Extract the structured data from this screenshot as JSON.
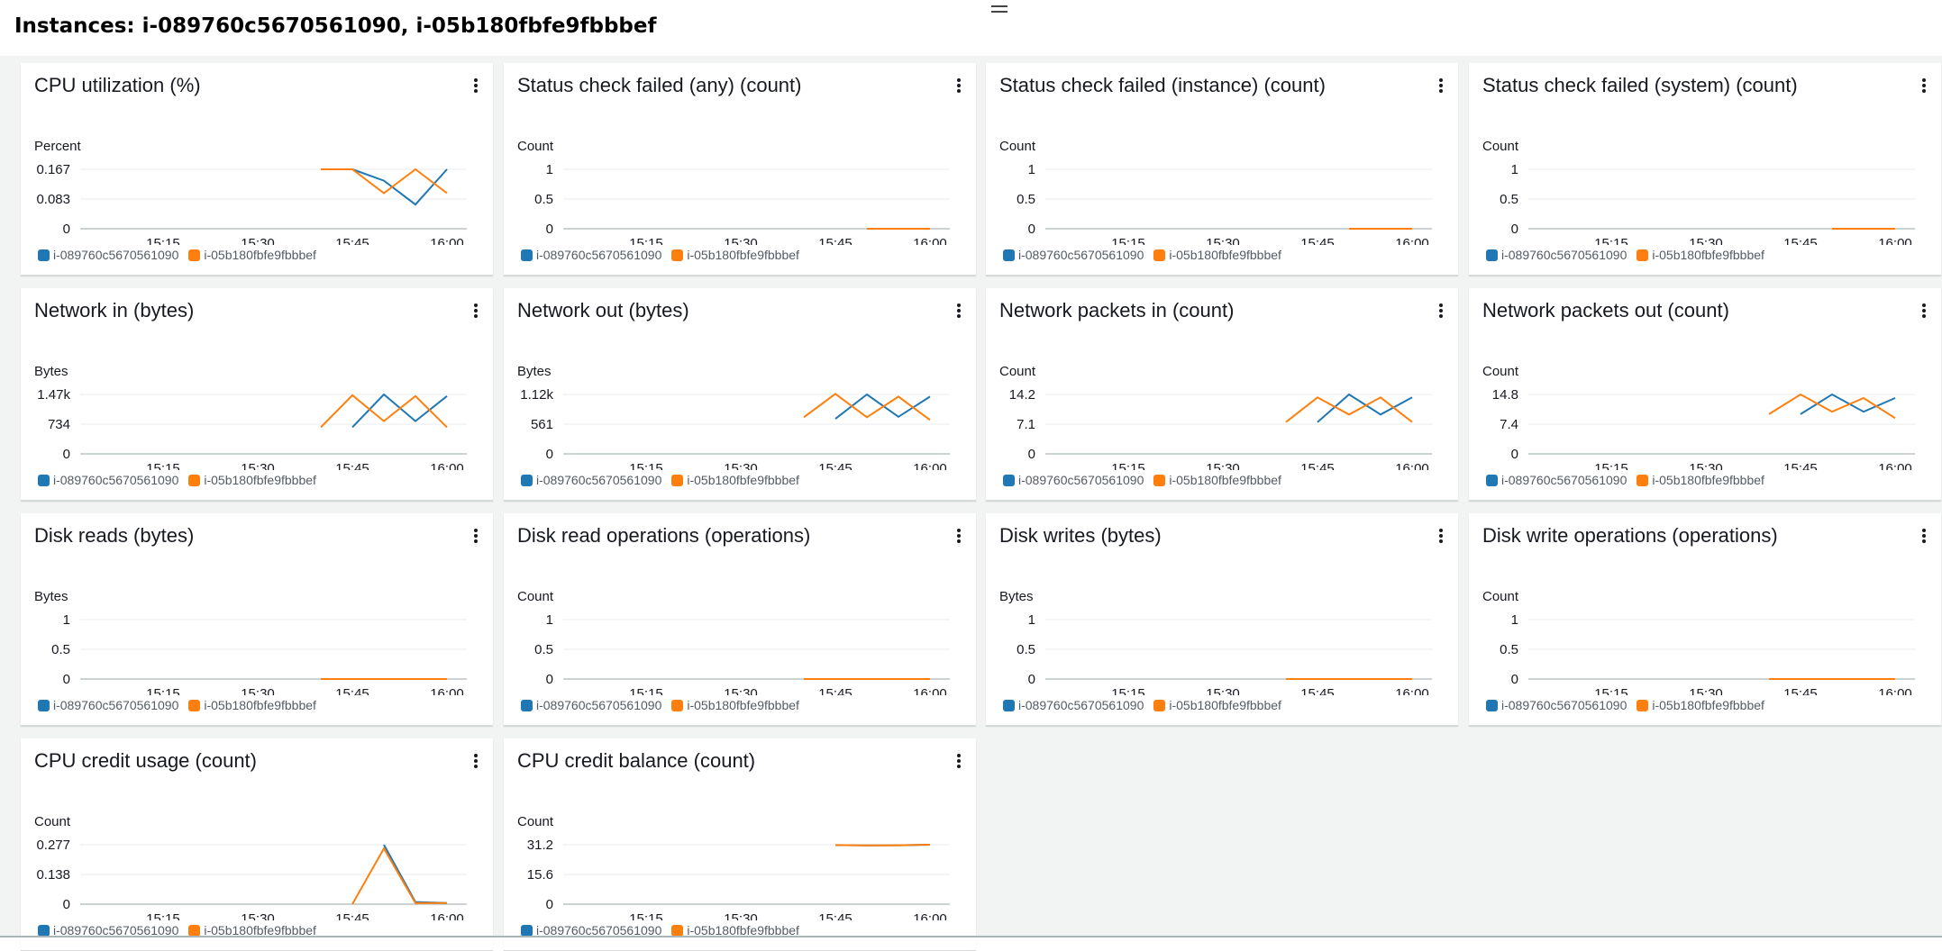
{
  "page": {
    "title": "Instances: i-089760c5670561090, i-05b180fbfe9fbbbef"
  },
  "colors": {
    "series_1": "#1f77b4",
    "series_2": "#ff7f0e",
    "grid": "#e9ebed",
    "axis": "#aab7b8"
  },
  "legend": [
    "i-089760c5670561090",
    "i-05b180fbfe9fbbbef"
  ],
  "widgets": [
    {
      "title": "CPU utilization (%)",
      "unit": "Percent",
      "yticks": [
        "0.167",
        "0.083",
        "0"
      ]
    },
    {
      "title": "Status check failed (any) (count)",
      "unit": "Count",
      "yticks": [
        "1",
        "0.5",
        "0"
      ]
    },
    {
      "title": "Status check failed (instance) (count)",
      "unit": "Count",
      "yticks": [
        "1",
        "0.5",
        "0"
      ]
    },
    {
      "title": "Status check failed (system) (count)",
      "unit": "Count",
      "yticks": [
        "1",
        "0.5",
        "0"
      ]
    },
    {
      "title": "Network in (bytes)",
      "unit": "Bytes",
      "yticks": [
        "1.47k",
        "734",
        "0"
      ]
    },
    {
      "title": "Network out (bytes)",
      "unit": "Bytes",
      "yticks": [
        "1.12k",
        "561",
        "0"
      ]
    },
    {
      "title": "Network packets in (count)",
      "unit": "Count",
      "yticks": [
        "14.2",
        "7.1",
        "0"
      ]
    },
    {
      "title": "Network packets out (count)",
      "unit": "Count",
      "yticks": [
        "14.8",
        "7.4",
        "0"
      ]
    },
    {
      "title": "Disk reads (bytes)",
      "unit": "Bytes",
      "yticks": [
        "1",
        "0.5",
        "0"
      ]
    },
    {
      "title": "Disk read operations (operations)",
      "unit": "Count",
      "yticks": [
        "1",
        "0.5",
        "0"
      ]
    },
    {
      "title": "Disk writes (bytes)",
      "unit": "Bytes",
      "yticks": [
        "1",
        "0.5",
        "0"
      ]
    },
    {
      "title": "Disk write operations (operations)",
      "unit": "Count",
      "yticks": [
        "1",
        "0.5",
        "0"
      ]
    },
    {
      "title": "CPU credit usage (count)",
      "unit": "Count",
      "yticks": [
        "0.277",
        "0.138",
        "0"
      ]
    },
    {
      "title": "CPU credit balance (count)",
      "unit": "Count",
      "yticks": [
        "31.2",
        "15.6",
        "0"
      ]
    }
  ],
  "chart_data": [
    {
      "type": "line",
      "title": "CPU utilization (%)",
      "ylabel": "Percent",
      "x": [
        "15:10",
        "15:15",
        "15:20",
        "15:25",
        "15:30",
        "15:35",
        "15:40",
        "15:45",
        "15:50",
        "15:55",
        "16:00"
      ],
      "ylim": [
        0,
        0.167
      ],
      "series": [
        {
          "name": "i-089760c5670561090",
          "values": [
            null,
            null,
            null,
            null,
            null,
            null,
            null,
            0.167,
            0.135,
            0.068,
            0.167
          ]
        },
        {
          "name": "i-05b180fbfe9fbbbef",
          "values": [
            null,
            null,
            null,
            null,
            null,
            null,
            0.167,
            0.167,
            0.1,
            0.167,
            0.1
          ]
        }
      ]
    },
    {
      "type": "line",
      "title": "Status check failed (any) (count)",
      "ylabel": "Count",
      "x": [
        "15:10",
        "15:15",
        "15:20",
        "15:25",
        "15:30",
        "15:35",
        "15:40",
        "15:45",
        "15:50",
        "15:55",
        "16:00"
      ],
      "ylim": [
        0,
        1
      ],
      "series": [
        {
          "name": "i-089760c5670561090",
          "values": [
            null,
            null,
            null,
            null,
            null,
            null,
            null,
            null,
            0,
            0,
            0
          ]
        },
        {
          "name": "i-05b180fbfe9fbbbef",
          "values": [
            null,
            null,
            null,
            null,
            null,
            null,
            null,
            null,
            0,
            0,
            0
          ]
        }
      ]
    },
    {
      "type": "line",
      "title": "Status check failed (instance) (count)",
      "ylabel": "Count",
      "x": [
        "15:10",
        "15:15",
        "15:20",
        "15:25",
        "15:30",
        "15:35",
        "15:40",
        "15:45",
        "15:50",
        "15:55",
        "16:00"
      ],
      "ylim": [
        0,
        1
      ],
      "series": [
        {
          "name": "i-089760c5670561090",
          "values": [
            null,
            null,
            null,
            null,
            null,
            null,
            null,
            null,
            0,
            0,
            0
          ]
        },
        {
          "name": "i-05b180fbfe9fbbbef",
          "values": [
            null,
            null,
            null,
            null,
            null,
            null,
            null,
            null,
            0,
            0,
            0
          ]
        }
      ]
    },
    {
      "type": "line",
      "title": "Status check failed (system) (count)",
      "ylabel": "Count",
      "x": [
        "15:10",
        "15:15",
        "15:20",
        "15:25",
        "15:30",
        "15:35",
        "15:40",
        "15:45",
        "15:50",
        "15:55",
        "16:00"
      ],
      "ylim": [
        0,
        1
      ],
      "series": [
        {
          "name": "i-089760c5670561090",
          "values": [
            null,
            null,
            null,
            null,
            null,
            null,
            null,
            null,
            0,
            0,
            0
          ]
        },
        {
          "name": "i-05b180fbfe9fbbbef",
          "values": [
            null,
            null,
            null,
            null,
            null,
            null,
            null,
            null,
            0,
            0,
            0
          ]
        }
      ]
    },
    {
      "type": "line",
      "title": "Network in (bytes)",
      "ylabel": "Bytes",
      "x": [
        "15:10",
        "15:15",
        "15:20",
        "15:25",
        "15:30",
        "15:35",
        "15:40",
        "15:45",
        "15:50",
        "15:55",
        "16:00"
      ],
      "ylim": [
        0,
        1470
      ],
      "series": [
        {
          "name": "i-089760c5670561090",
          "values": [
            null,
            null,
            null,
            null,
            null,
            null,
            null,
            660,
            1470,
            810,
            1430
          ]
        },
        {
          "name": "i-05b180fbfe9fbbbef",
          "values": [
            null,
            null,
            null,
            null,
            null,
            null,
            660,
            1450,
            810,
            1430,
            660
          ]
        }
      ]
    },
    {
      "type": "line",
      "title": "Network out (bytes)",
      "ylabel": "Bytes",
      "x": [
        "15:10",
        "15:15",
        "15:20",
        "15:25",
        "15:30",
        "15:35",
        "15:40",
        "15:45",
        "15:50",
        "15:55",
        "16:00"
      ],
      "ylim": [
        0,
        1120
      ],
      "series": [
        {
          "name": "i-089760c5670561090",
          "values": [
            null,
            null,
            null,
            null,
            null,
            null,
            null,
            660,
            1120,
            700,
            1080
          ]
        },
        {
          "name": "i-05b180fbfe9fbbbef",
          "values": [
            null,
            null,
            null,
            null,
            null,
            null,
            690,
            1130,
            690,
            1080,
            640
          ]
        }
      ]
    },
    {
      "type": "line",
      "title": "Network packets in (count)",
      "ylabel": "Count",
      "x": [
        "15:10",
        "15:15",
        "15:20",
        "15:25",
        "15:30",
        "15:35",
        "15:40",
        "15:45",
        "15:50",
        "15:55",
        "16:00"
      ],
      "ylim": [
        0,
        14.2
      ],
      "series": [
        {
          "name": "i-089760c5670561090",
          "values": [
            null,
            null,
            null,
            null,
            null,
            null,
            null,
            7.6,
            14.2,
            9.4,
            13.5
          ]
        },
        {
          "name": "i-05b180fbfe9fbbbef",
          "values": [
            null,
            null,
            null,
            null,
            null,
            null,
            7.6,
            13.5,
            9.4,
            13.5,
            7.6
          ]
        }
      ]
    },
    {
      "type": "line",
      "title": "Network packets out (count)",
      "ylabel": "Count",
      "x": [
        "15:10",
        "15:15",
        "15:20",
        "15:25",
        "15:30",
        "15:35",
        "15:40",
        "15:45",
        "15:50",
        "15:55",
        "16:00"
      ],
      "ylim": [
        0,
        14.8
      ],
      "series": [
        {
          "name": "i-089760c5670561090",
          "values": [
            null,
            null,
            null,
            null,
            null,
            null,
            null,
            9.9,
            14.8,
            10.5,
            13.9
          ]
        },
        {
          "name": "i-05b180fbfe9fbbbef",
          "values": [
            null,
            null,
            null,
            null,
            null,
            null,
            9.9,
            14.8,
            10.5,
            13.9,
            8.9
          ]
        }
      ]
    },
    {
      "type": "line",
      "title": "Disk reads (bytes)",
      "ylabel": "Bytes",
      "x": [
        "15:10",
        "15:15",
        "15:20",
        "15:25",
        "15:30",
        "15:35",
        "15:40",
        "15:45",
        "15:50",
        "15:55",
        "16:00"
      ],
      "ylim": [
        0,
        1
      ],
      "series": [
        {
          "name": "i-089760c5670561090",
          "values": [
            null,
            null,
            null,
            null,
            null,
            null,
            null,
            0,
            0,
            0,
            0
          ]
        },
        {
          "name": "i-05b180fbfe9fbbbef",
          "values": [
            null,
            null,
            null,
            null,
            null,
            null,
            0,
            0,
            0,
            0,
            0
          ]
        }
      ]
    },
    {
      "type": "line",
      "title": "Disk read operations (operations)",
      "ylabel": "Count",
      "x": [
        "15:10",
        "15:15",
        "15:20",
        "15:25",
        "15:30",
        "15:35",
        "15:40",
        "15:45",
        "15:50",
        "15:55",
        "16:00"
      ],
      "ylim": [
        0,
        1
      ],
      "series": [
        {
          "name": "i-089760c5670561090",
          "values": [
            null,
            null,
            null,
            null,
            null,
            null,
            null,
            0,
            0,
            0,
            0
          ]
        },
        {
          "name": "i-05b180fbfe9fbbbef",
          "values": [
            null,
            null,
            null,
            null,
            null,
            null,
            0,
            0,
            0,
            0,
            0
          ]
        }
      ]
    },
    {
      "type": "line",
      "title": "Disk writes (bytes)",
      "ylabel": "Bytes",
      "x": [
        "15:10",
        "15:15",
        "15:20",
        "15:25",
        "15:30",
        "15:35",
        "15:40",
        "15:45",
        "15:50",
        "15:55",
        "16:00"
      ],
      "ylim": [
        0,
        1
      ],
      "series": [
        {
          "name": "i-089760c5670561090",
          "values": [
            null,
            null,
            null,
            null,
            null,
            null,
            null,
            0,
            0,
            0,
            0
          ]
        },
        {
          "name": "i-05b180fbfe9fbbbef",
          "values": [
            null,
            null,
            null,
            null,
            null,
            null,
            0,
            0,
            0,
            0,
            0
          ]
        }
      ]
    },
    {
      "type": "line",
      "title": "Disk write operations (operations)",
      "ylabel": "Count",
      "x": [
        "15:10",
        "15:15",
        "15:20",
        "15:25",
        "15:30",
        "15:35",
        "15:40",
        "15:45",
        "15:50",
        "15:55",
        "16:00"
      ],
      "ylim": [
        0,
        1
      ],
      "series": [
        {
          "name": "i-089760c5670561090",
          "values": [
            null,
            null,
            null,
            null,
            null,
            null,
            null,
            0,
            0,
            0,
            0
          ]
        },
        {
          "name": "i-05b180fbfe9fbbbef",
          "values": [
            null,
            null,
            null,
            null,
            null,
            null,
            0,
            0,
            0,
            0,
            0
          ]
        }
      ]
    },
    {
      "type": "line",
      "title": "CPU credit usage (count)",
      "ylabel": "Count",
      "x": [
        "15:10",
        "15:15",
        "15:20",
        "15:25",
        "15:30",
        "15:35",
        "15:40",
        "15:45",
        "15:50",
        "15:55",
        "16:00"
      ],
      "ylim": [
        0,
        0.277
      ],
      "series": [
        {
          "name": "i-089760c5670561090",
          "values": [
            null,
            null,
            null,
            null,
            null,
            null,
            null,
            null,
            0.277,
            0.01,
            0.005
          ]
        },
        {
          "name": "i-05b180fbfe9fbbbef",
          "values": [
            null,
            null,
            null,
            null,
            null,
            null,
            null,
            0,
            0.26,
            0.005,
            0.005
          ]
        }
      ]
    },
    {
      "type": "line",
      "title": "CPU credit balance (count)",
      "ylabel": "Count",
      "x": [
        "15:10",
        "15:15",
        "15:20",
        "15:25",
        "15:30",
        "15:35",
        "15:40",
        "15:45",
        "15:50",
        "15:55",
        "16:00"
      ],
      "ylim": [
        0,
        31.2
      ],
      "series": [
        {
          "name": "i-089760c5670561090",
          "values": [
            null,
            null,
            null,
            null,
            null,
            null,
            null,
            31.0,
            30.8,
            30.9,
            31.2
          ]
        },
        {
          "name": "i-05b180fbfe9fbbbef",
          "values": [
            null,
            null,
            null,
            null,
            null,
            null,
            null,
            31.0,
            30.8,
            30.9,
            31.2
          ]
        }
      ]
    }
  ],
  "xticks": [
    "15:15",
    "15:30",
    "15:45",
    "16:00"
  ]
}
